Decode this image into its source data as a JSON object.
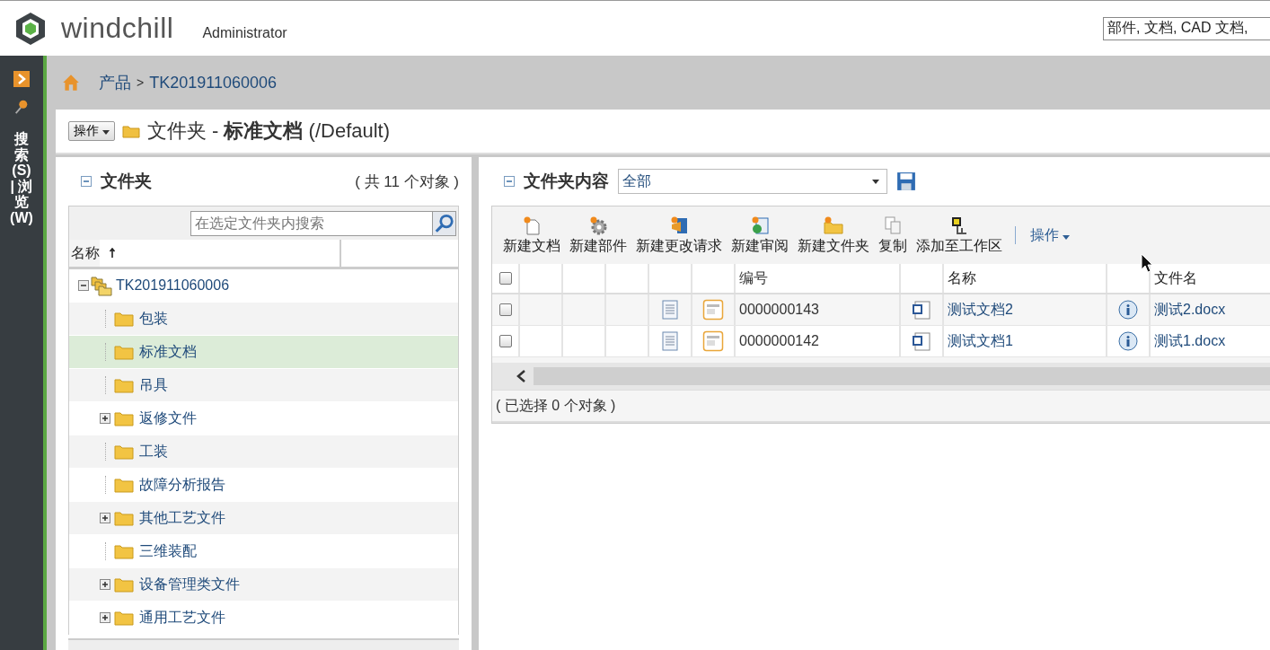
{
  "header": {
    "logo_text": "windchill",
    "user": "Administrator",
    "search": {
      "value": "部件, 文档, CAD 文档,"
    }
  },
  "sidebar": {
    "tab_label": "搜索(S) | 浏览(W)"
  },
  "breadcrumb": {
    "items": [
      "产品",
      "TK201911060006"
    ],
    "separator": ">"
  },
  "page_header": {
    "actions_button": "操作",
    "title": "文件夹 - **标准文档** (/Default)"
  },
  "folders_panel": {
    "title": "文件夹",
    "count": "( 共 11 个对象 )",
    "search_placeholder": "在选定文件夹内搜索",
    "column": "名称",
    "tree": [
      {
        "label": "TK201911060006",
        "kind": "product",
        "expanded": true,
        "selected": false,
        "children": [
          {
            "label": "包装",
            "kind": "folder",
            "expandable": false,
            "selected": false
          },
          {
            "label": "标准文档",
            "kind": "folder",
            "expandable": false,
            "selected": true
          },
          {
            "label": "吊具",
            "kind": "folder",
            "expandable": false,
            "selected": false
          },
          {
            "label": "返修文件",
            "kind": "folder",
            "expandable": true,
            "selected": false
          },
          {
            "label": "工装",
            "kind": "folder",
            "expandable": false,
            "selected": false
          },
          {
            "label": "故障分析报告",
            "kind": "folder",
            "expandable": false,
            "selected": false
          },
          {
            "label": "其他工艺文件",
            "kind": "folder",
            "expandable": true,
            "selected": false
          },
          {
            "label": "三维装配",
            "kind": "folder",
            "expandable": false,
            "selected": false
          },
          {
            "label": "设备管理类文件",
            "kind": "folder",
            "expandable": true,
            "selected": false
          },
          {
            "label": "通用工艺文件",
            "kind": "folder",
            "expandable": true,
            "selected": false
          }
        ]
      }
    ]
  },
  "contents_panel": {
    "title": "文件夹内容",
    "view": "全部",
    "toolbar": [
      {
        "label": "新建文档",
        "kind": "doc"
      },
      {
        "label": "新建部件",
        "kind": "part"
      },
      {
        "label": "新建更改请求",
        "kind": "change"
      },
      {
        "label": "新建审阅",
        "kind": "review"
      },
      {
        "label": "新建文件夹",
        "kind": "folder"
      },
      {
        "label": "复制",
        "kind": "copy"
      },
      {
        "label": "添加至工作区",
        "kind": "workspace"
      }
    ],
    "actions_menu": "操作",
    "all_selected": false,
    "columns": [
      "编号",
      "名称",
      "文件名"
    ],
    "rows": [
      {
        "selected": false,
        "number": "0000000143",
        "name": "测试文档2",
        "file": "测试2.docx"
      },
      {
        "selected": false,
        "number": "0000000142",
        "name": "测试文档1",
        "file": "测试1.docx"
      }
    ],
    "status": "( 已选择 0 个对象 )"
  }
}
